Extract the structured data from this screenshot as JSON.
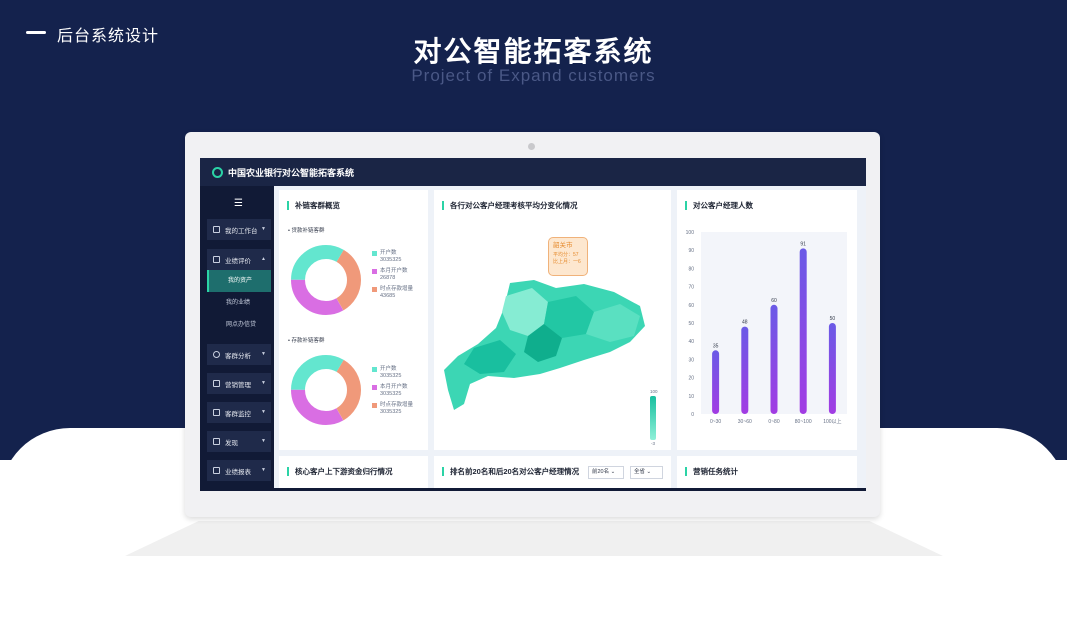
{
  "slide": {
    "brand": "后台系统设计",
    "title": "对公智能拓客系统",
    "subtitle": "Project of Expand customers"
  },
  "app": {
    "title": "中国农业银行对公智能拓客系统"
  },
  "sidebar": {
    "items": [
      {
        "label": "我的工作台",
        "icon": "workbench-icon"
      },
      {
        "label": "业绩评价",
        "icon": "comment-icon"
      },
      {
        "label": "客群分析",
        "icon": "pie-icon"
      },
      {
        "label": "营销管理",
        "icon": "sliders-icon"
      },
      {
        "label": "客群监控",
        "icon": "monitor-icon"
      },
      {
        "label": "发现",
        "icon": "grid-icon"
      },
      {
        "label": "业绩报表",
        "icon": "report-icon"
      }
    ],
    "subitems": [
      "我的资产",
      "我的业绩",
      "网点办信贷"
    ]
  },
  "panels": {
    "overview_title": "补链客群概览",
    "loan_label": "贷款补链客群",
    "deposit_label": "存款补链客群",
    "loan_legend": [
      {
        "name": "开户数",
        "value": "3035325",
        "color": "#63e6cf"
      },
      {
        "name": "本月开户数",
        "value": "26878",
        "color": "#d96ee3"
      },
      {
        "name": "时点存款增量",
        "value": "43685",
        "color": "#f0997a"
      }
    ],
    "deposit_legend": [
      {
        "name": "开户数",
        "value": "3035325",
        "color": "#63e6cf"
      },
      {
        "name": "本月开户数",
        "value": "3035325",
        "color": "#d96ee3"
      },
      {
        "name": "时点存款增量",
        "value": "3035325",
        "color": "#f0997a"
      }
    ],
    "map_title": "各行对公客户经理考核平均分变化情况",
    "map_tooltip": {
      "city": "韶关市",
      "avg": "平均分：57",
      "delta": "比上月：一6"
    },
    "map_scale": {
      "max": "100",
      "min": "-3"
    },
    "managers_title": "对公客户经理人数",
    "core_title": "核心客户上下游资金归行情况",
    "rank_title": "排名前20名和后20名对公客户经理情况",
    "rank_filter": "前20名",
    "province_filter": "全省",
    "task_title": "营销任务统计"
  },
  "chart_data": {
    "type": "bar",
    "categories": [
      "0~30",
      "30~60",
      "0~80",
      "80~100",
      "100以上"
    ],
    "values": [
      35,
      48,
      60,
      91,
      50
    ],
    "ylim": [
      0,
      100
    ],
    "yticks": [
      0,
      10,
      20,
      30,
      40,
      50,
      60,
      70,
      80,
      90,
      100
    ]
  }
}
